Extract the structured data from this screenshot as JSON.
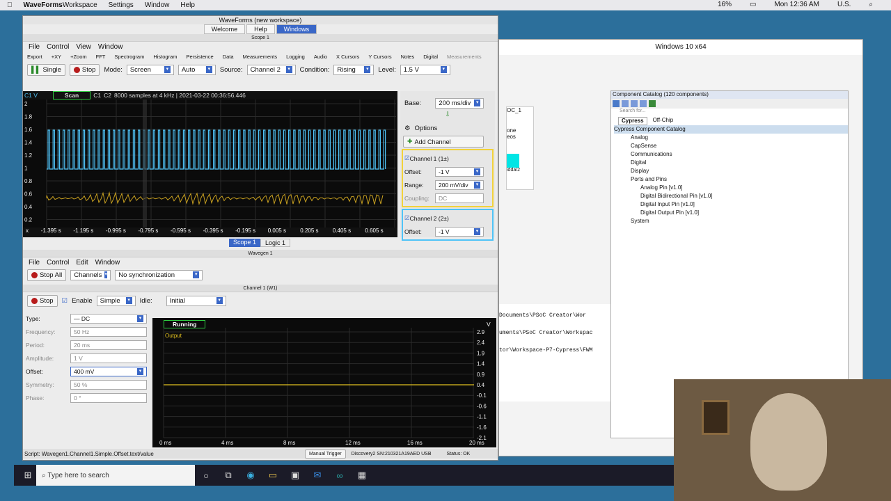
{
  "macbar": {
    "app": "WaveForms",
    "menus": [
      "Workspace",
      "Settings",
      "Window",
      "Help"
    ],
    "battery": "16%",
    "clock": "Mon 12:36 AM",
    "locale": "U.S."
  },
  "win10": {
    "title": "Windows 10 x64"
  },
  "waveforms": {
    "title": "WaveForms (new workspace)",
    "tabs": [
      "Welcome",
      "Help",
      "Windows"
    ],
    "scope": {
      "panel_title": "Scope 1",
      "menu": [
        "File",
        "Control",
        "View",
        "Window"
      ],
      "tools": [
        "Export",
        "+XY",
        "+Zoom",
        "FFT",
        "Spectrogram",
        "Histogram",
        "Persistence",
        "Data",
        "Measurements",
        "Logging",
        "Audio",
        "X Cursors",
        "Y Cursors",
        "Notes",
        "Digital",
        "Measurements"
      ],
      "single": "Single",
      "stop": "Stop",
      "mode_label": "Mode:",
      "mode": "Screen",
      "auto": "Auto",
      "source_label": "Source:",
      "source": "Channel 2",
      "condition_label": "Condition:",
      "condition": "Rising",
      "level_label": "Level:",
      "level": "1.5 V",
      "c1v": "C1 V",
      "scan": "Scan",
      "c1": "C1",
      "c2": "C2",
      "info": "8000 samples at 4 kHz | 2021-03-22 00:36:56.446",
      "yticks": [
        "2",
        "1.8",
        "1.6",
        "1.4",
        "1.2",
        "1",
        "0.8",
        "0.6",
        "0.4",
        "0.2"
      ],
      "x_label": "x",
      "xticks": [
        "-1.395 s",
        "-1.195 s",
        "-0.995 s",
        "-0.795 s",
        "-0.595 s",
        "-0.395 s",
        "-0.195 s",
        "0.005 s",
        "0.205 s",
        "0.405 s",
        "0.605 s"
      ],
      "base_label": "Base:",
      "base": "200 ms/div",
      "options": "Options",
      "add_channel": "Add Channel",
      "ch1": "Channel 1 (1±)",
      "offset_label": "Offset:",
      "ch1_offset": "-1 V",
      "range_label": "Range:",
      "ch1_range": "200 mV/div",
      "coupling_label": "Coupling:",
      "coupling": "DC",
      "ch2": "Channel 2 (2±)",
      "ch2_offset": "-1 V",
      "bottom_tabs": [
        "Scope 1",
        "Logic 1"
      ]
    },
    "wavegen": {
      "panel_title": "Wavegen 1",
      "menu": [
        "File",
        "Control",
        "Edit",
        "Window"
      ],
      "stop_all": "Stop All",
      "channels": "Channels",
      "sync": "No synchronization",
      "ch_title": "Channel 1 (W1)",
      "stop": "Stop",
      "enable": "Enable",
      "simple": "Simple",
      "idle_label": "Idle:",
      "idle": "Initial",
      "fields": [
        {
          "label": "Type:",
          "value": "— DC",
          "active": true
        },
        {
          "label": "Frequency:",
          "value": "50 Hz",
          "active": false
        },
        {
          "label": "Period:",
          "value": "20 ms",
          "active": false
        },
        {
          "label": "Amplitude:",
          "value": "1 V",
          "active": false
        },
        {
          "label": "Offset:",
          "value": "400 mV",
          "active": true
        },
        {
          "label": "Symmetry:",
          "value": "50 %",
          "active": false
        },
        {
          "label": "Phase:",
          "value": "0 °",
          "active": false
        }
      ],
      "running": "Running",
      "output": "Output",
      "v_unit": "V",
      "yticks": [
        "2.9",
        "2.4",
        "1.9",
        "1.4",
        "0.9",
        "0.4",
        "-0.1",
        "-0.6",
        "-1.1",
        "-1.6",
        "-2.1"
      ],
      "xticks": [
        "0 ms",
        "4 ms",
        "8 ms",
        "12 ms",
        "16 ms",
        "20 ms"
      ],
      "offset_value": 0.4
    },
    "status": {
      "script": "Script: Wavegen1.Channel1.Simple.Offset.text/value",
      "manual": "Manual Trigger",
      "device": "Discovery2 SN:210321A19AED USB",
      "status": "Status: OK"
    }
  },
  "catalog": {
    "title": "Component Catalog (120 components)",
    "search": "Search for...",
    "tabs": [
      "Cypress",
      "Off-Chip"
    ],
    "root": "Cypress Component Catalog",
    "items": [
      "Analog",
      "CapSense",
      "Communications",
      "Digital",
      "Display",
      "Ports and Pins"
    ],
    "pins": [
      "Analog Pin [v1.0]",
      "Digital Bidirectional Pin [v1.0]",
      "Digital Input Pin [v1.0]",
      "Digital Output Pin [v1.0]"
    ],
    "last": "System"
  },
  "bg_texts": [
    "Documents\\PSoC Creator\\Wor",
    "uments\\PSoC Creator\\Workspac",
    "tor\\Workspace-P7-Cypress\\FWM"
  ],
  "canvas_texts": [
    "OC_1",
    "one",
    "eos",
    "idda/2"
  ],
  "taskbar": {
    "search": "Type here to search"
  }
}
